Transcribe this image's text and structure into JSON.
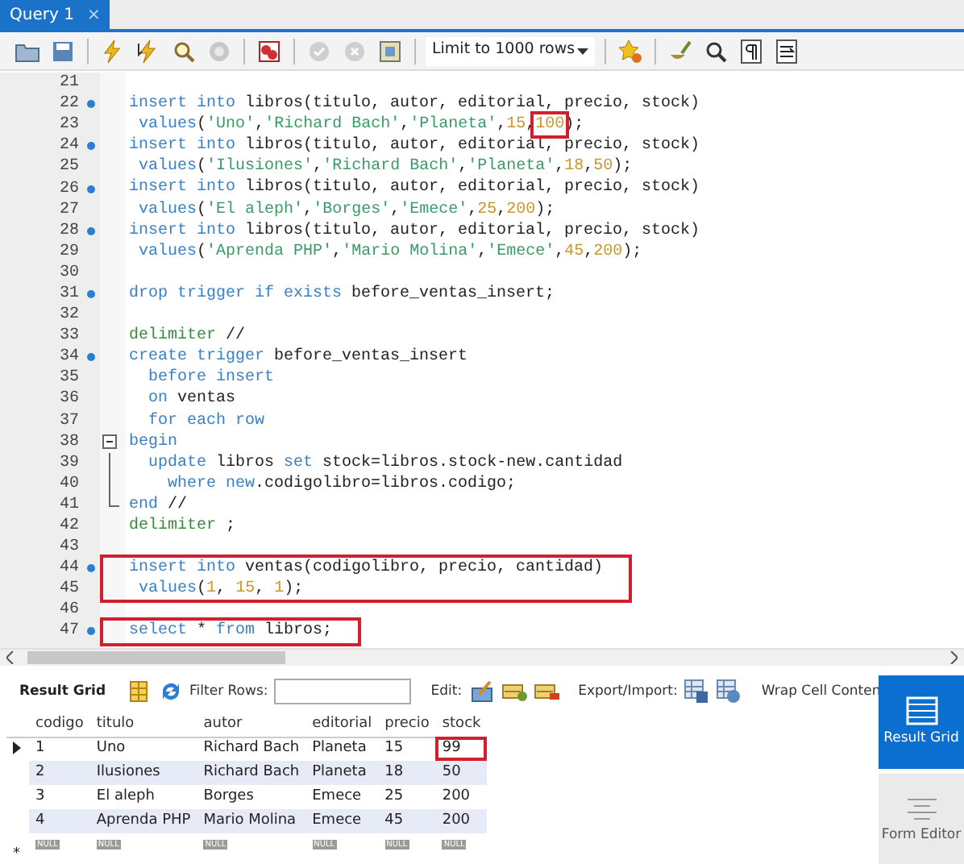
{
  "tabs": [
    {
      "label": "Query 1",
      "close": "×",
      "selected": true
    }
  ],
  "toolbar": {
    "limit": "Limit to 1000 rows"
  },
  "editor": {
    "lines": [
      {
        "number": "21",
        "marker": false
      },
      {
        "number": "22",
        "marker": true,
        "tokens": [
          {
            "kind": "keyword",
            "text": "insert into"
          },
          {
            "kind": "plain",
            "text": " libros(titulo, autor, editorial, precio, stock)"
          }
        ]
      },
      {
        "number": "23",
        "marker": false,
        "tokens": [
          {
            "kind": "keyword",
            "text": " values"
          },
          {
            "kind": "plain",
            "text": "("
          },
          {
            "kind": "string",
            "text": "'Uno'"
          },
          {
            "kind": "plain",
            "text": ","
          },
          {
            "kind": "string",
            "text": "'Richard Bach'"
          },
          {
            "kind": "plain",
            "text": ","
          },
          {
            "kind": "string",
            "text": "'Planeta'"
          },
          {
            "kind": "plain",
            "text": ","
          },
          {
            "kind": "number",
            "text": "15"
          },
          {
            "kind": "plain",
            "text": ","
          },
          {
            "kind": "number",
            "text": "100",
            "boxed": true
          },
          {
            "kind": "plain",
            "text": ");"
          }
        ]
      },
      {
        "number": "24",
        "marker": true,
        "tokens": [
          {
            "kind": "keyword",
            "text": "insert into"
          },
          {
            "kind": "plain",
            "text": " libros(titulo, autor, editorial, precio, stock)"
          }
        ]
      },
      {
        "number": "25",
        "marker": false,
        "tokens": [
          {
            "kind": "keyword",
            "text": " values"
          },
          {
            "kind": "plain",
            "text": "("
          },
          {
            "kind": "string",
            "text": "'Ilusiones'"
          },
          {
            "kind": "plain",
            "text": ","
          },
          {
            "kind": "string",
            "text": "'Richard Bach'"
          },
          {
            "kind": "plain",
            "text": ","
          },
          {
            "kind": "string",
            "text": "'Planeta'"
          },
          {
            "kind": "plain",
            "text": ","
          },
          {
            "kind": "number",
            "text": "18"
          },
          {
            "kind": "plain",
            "text": ","
          },
          {
            "kind": "number",
            "text": "50"
          },
          {
            "kind": "plain",
            "text": ");"
          }
        ]
      },
      {
        "number": "26",
        "marker": true,
        "tokens": [
          {
            "kind": "keyword",
            "text": "insert into"
          },
          {
            "kind": "plain",
            "text": " libros(titulo, autor, editorial, precio, stock)"
          }
        ]
      },
      {
        "number": "27",
        "marker": false,
        "tokens": [
          {
            "kind": "keyword",
            "text": " values"
          },
          {
            "kind": "plain",
            "text": "("
          },
          {
            "kind": "string",
            "text": "'El aleph'"
          },
          {
            "kind": "plain",
            "text": ","
          },
          {
            "kind": "string",
            "text": "'Borges'"
          },
          {
            "kind": "plain",
            "text": ","
          },
          {
            "kind": "string",
            "text": "'Emece'"
          },
          {
            "kind": "plain",
            "text": ","
          },
          {
            "kind": "number",
            "text": "25"
          },
          {
            "kind": "plain",
            "text": ","
          },
          {
            "kind": "number",
            "text": "200"
          },
          {
            "kind": "plain",
            "text": ");"
          }
        ]
      },
      {
        "number": "28",
        "marker": true,
        "tokens": [
          {
            "kind": "keyword",
            "text": "insert into"
          },
          {
            "kind": "plain",
            "text": " libros(titulo, autor, editorial, precio, stock)"
          }
        ]
      },
      {
        "number": "29",
        "marker": false,
        "tokens": [
          {
            "kind": "keyword",
            "text": " values"
          },
          {
            "kind": "plain",
            "text": "("
          },
          {
            "kind": "string",
            "text": "'Aprenda PHP'"
          },
          {
            "kind": "plain",
            "text": ","
          },
          {
            "kind": "string",
            "text": "'Mario Molina'"
          },
          {
            "kind": "plain",
            "text": ","
          },
          {
            "kind": "string",
            "text": "'Emece'"
          },
          {
            "kind": "plain",
            "text": ","
          },
          {
            "kind": "number",
            "text": "45"
          },
          {
            "kind": "plain",
            "text": ","
          },
          {
            "kind": "number",
            "text": "200"
          },
          {
            "kind": "plain",
            "text": ");"
          }
        ]
      },
      {
        "number": "30",
        "marker": false
      },
      {
        "number": "31",
        "marker": true,
        "tokens": [
          {
            "kind": "keyword",
            "text": "drop trigger if exists"
          },
          {
            "kind": "plain",
            "text": " before_ventas_insert;"
          }
        ]
      },
      {
        "number": "32",
        "marker": false
      },
      {
        "number": "33",
        "marker": false,
        "tokens": [
          {
            "kind": "directive",
            "text": "delimiter"
          },
          {
            "kind": "plain",
            "text": " //"
          }
        ]
      },
      {
        "number": "34",
        "marker": true,
        "tokens": [
          {
            "kind": "keyword",
            "text": "create trigger"
          },
          {
            "kind": "plain",
            "text": " before_ventas_insert"
          }
        ]
      },
      {
        "number": "35",
        "marker": false,
        "tokens": [
          {
            "kind": "keyword",
            "text": "  before insert"
          }
        ]
      },
      {
        "number": "36",
        "marker": false,
        "tokens": [
          {
            "kind": "keyword",
            "text": "  on"
          },
          {
            "kind": "plain",
            "text": " ventas"
          }
        ]
      },
      {
        "number": "37",
        "marker": false,
        "tokens": [
          {
            "kind": "keyword",
            "text": "  for each row"
          }
        ]
      },
      {
        "number": "38",
        "marker": false,
        "expanded": true,
        "tokens": [
          {
            "kind": "keyword",
            "text": "begin"
          }
        ],
        "children": [
          {
            "number": "39",
            "marker": false,
            "tokens": [
              {
                "kind": "keyword",
                "text": "  update"
              },
              {
                "kind": "plain",
                "text": " libros "
              },
              {
                "kind": "keyword",
                "text": "set"
              },
              {
                "kind": "plain",
                "text": " stock=libros.stock-new.cantidad"
              }
            ]
          },
          {
            "number": "40",
            "marker": false,
            "tokens": [
              {
                "kind": "keyword",
                "text": "    where new"
              },
              {
                "kind": "plain",
                "text": ".codigolibro=libros.codigo;"
              }
            ]
          },
          {
            "number": "41",
            "marker": false,
            "tokens": [
              {
                "kind": "keyword",
                "text": "end"
              },
              {
                "kind": "plain",
                "text": " //"
              }
            ]
          }
        ]
      },
      {
        "number": "42",
        "marker": false,
        "tokens": [
          {
            "kind": "directive",
            "text": "delimiter"
          },
          {
            "kind": "plain",
            "text": " ;"
          }
        ]
      },
      {
        "number": "43",
        "marker": false
      },
      {
        "number": "44",
        "marker": true,
        "outlined": true,
        "tokens": [
          {
            "kind": "keyword",
            "text": "insert into"
          },
          {
            "kind": "plain",
            "text": " ventas(codigolibro, precio, cantidad)"
          }
        ]
      },
      {
        "number": "45",
        "marker": false,
        "outlined": true,
        "tokens": [
          {
            "kind": "keyword",
            "text": " values"
          },
          {
            "kind": "plain",
            "text": "("
          },
          {
            "kind": "number",
            "text": "1"
          },
          {
            "kind": "plain",
            "text": ", "
          },
          {
            "kind": "number",
            "text": "15"
          },
          {
            "kind": "plain",
            "text": ", "
          },
          {
            "kind": "number",
            "text": "1"
          },
          {
            "kind": "plain",
            "text": ");"
          }
        ]
      },
      {
        "number": "46",
        "marker": false
      },
      {
        "number": "47",
        "marker": true,
        "outlined": true,
        "tokens": [
          {
            "kind": "keyword",
            "text": "select"
          },
          {
            "kind": "plain",
            "text": " * "
          },
          {
            "kind": "keyword",
            "text": "from"
          },
          {
            "kind": "plain",
            "text": " libros;"
          }
        ]
      }
    ]
  },
  "result_toolbar": {
    "title": "Result Grid",
    "filter_label": "Filter Rows:",
    "edit_label": "Edit:",
    "export_label": "Export/Import:",
    "wrap_label": "Wrap Cell Conten"
  },
  "grid": {
    "columns": [
      "codigo",
      "titulo",
      "autor",
      "editorial",
      "precio",
      "stock"
    ],
    "rows": [
      {
        "selected": true,
        "cells": [
          {
            "text": "1"
          },
          {
            "text": "Uno"
          },
          {
            "text": "Richard Bach"
          },
          {
            "text": "Planeta"
          },
          {
            "text": "15"
          },
          {
            "text": "99",
            "outlined": true
          }
        ]
      },
      {
        "selected": false,
        "cells": [
          {
            "text": "2"
          },
          {
            "text": "Ilusiones"
          },
          {
            "text": "Richard Bach"
          },
          {
            "text": "Planeta"
          },
          {
            "text": "18"
          },
          {
            "text": "50"
          }
        ]
      },
      {
        "selected": false,
        "cells": [
          {
            "text": "3"
          },
          {
            "text": "El aleph"
          },
          {
            "text": "Borges"
          },
          {
            "text": "Emece"
          },
          {
            "text": "25"
          },
          {
            "text": "200"
          }
        ]
      },
      {
        "selected": false,
        "cells": [
          {
            "text": "4"
          },
          {
            "text": "Aprenda PHP"
          },
          {
            "text": "Mario Molina"
          },
          {
            "text": "Emece"
          },
          {
            "text": "45"
          },
          {
            "text": "200"
          }
        ]
      }
    ],
    "new_row": {
      "marker": "*",
      "cells": [
        "NULL",
        "NULL",
        "NULL",
        "NULL",
        "NULL",
        "NULL"
      ]
    }
  },
  "side_panel": [
    {
      "label": "Result Grid",
      "selected": true
    },
    {
      "label": "Form Editor",
      "selected": false
    }
  ]
}
